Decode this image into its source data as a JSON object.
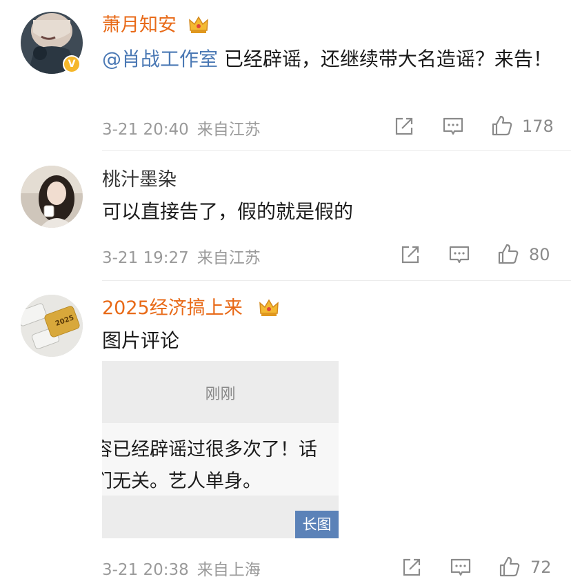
{
  "colors": {
    "username_highlight": "#e86a18",
    "mention": "#4a78b4",
    "meta": "#9a9a9a",
    "verified_badge": "#f5b72b",
    "long_image_badge": "#5b82b8"
  },
  "comments": [
    {
      "username": "萧月知安",
      "verified_badge": "V",
      "crown_icon": "crown-icon",
      "mention": "@肖战工作室",
      "text": " 已经辟谣，还继续带大名造谣？来告！",
      "date": "3-21 20:40",
      "location": "来自江苏",
      "likes": "178"
    },
    {
      "username": "桃汁墨染",
      "text": "可以直接告了，假的就是假的",
      "date": "3-21 19:27",
      "location": "来自江苏",
      "likes": "80"
    },
    {
      "username": "2025经济搞上来",
      "crown_icon": "crown-icon",
      "text": "图片评论",
      "image": {
        "title": "刚刚",
        "line1": "容已经辟谣过很多次了！话",
        "line2": "们无关。艺人单身。",
        "badge": "长图",
        "avatar_text": "2025"
      },
      "date": "3-21 20:38",
      "location": "来自上海",
      "likes": "72"
    }
  ]
}
